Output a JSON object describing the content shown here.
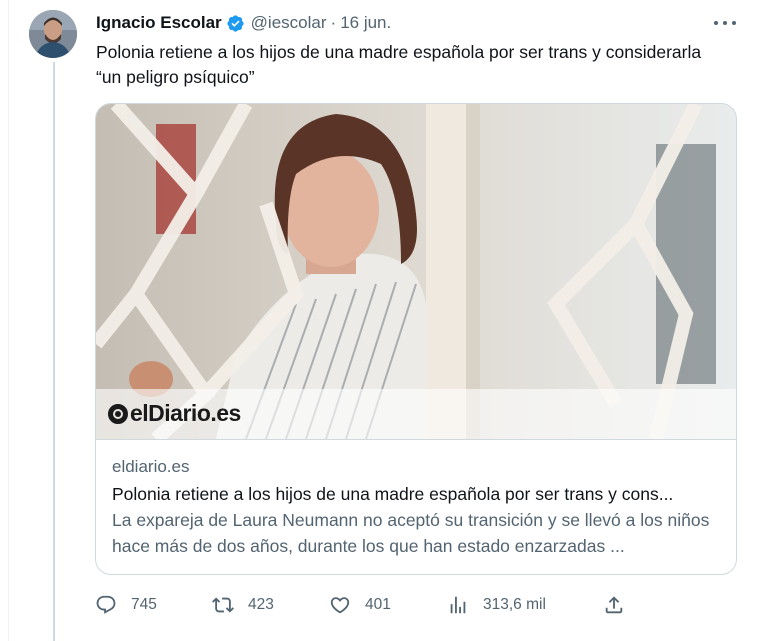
{
  "tweet": {
    "author_name": "Ignacio Escolar",
    "handle": "@iescolar",
    "separator": "·",
    "date": "16 jun.",
    "text": "Polonia retiene a los hijos de una madre española por ser trans y considerarla “un peligro psíquico”"
  },
  "card": {
    "logo_text": "elDiario.es",
    "domain": "eldiario.es",
    "title": "Polonia retiene a los hijos de una madre española por ser trans y cons...",
    "description": "La expareja de Laura Neumann no aceptó su transición y se llevó a los niños hace más de dos años, durante los que han estado enzarzadas ..."
  },
  "actions": {
    "replies": "745",
    "reposts": "423",
    "likes": "401",
    "views": "313,6 mil"
  },
  "icons": {
    "verified": "verified-badge-icon",
    "more": "more-options-icon",
    "reply": "reply-icon",
    "repost": "repost-icon",
    "like": "heart-icon",
    "views": "analytics-icon",
    "share": "share-icon"
  },
  "colors": {
    "text_primary": "#0f1419",
    "text_secondary": "#536471",
    "verified_blue": "#1d9bf0",
    "border": "#cfd9de"
  }
}
